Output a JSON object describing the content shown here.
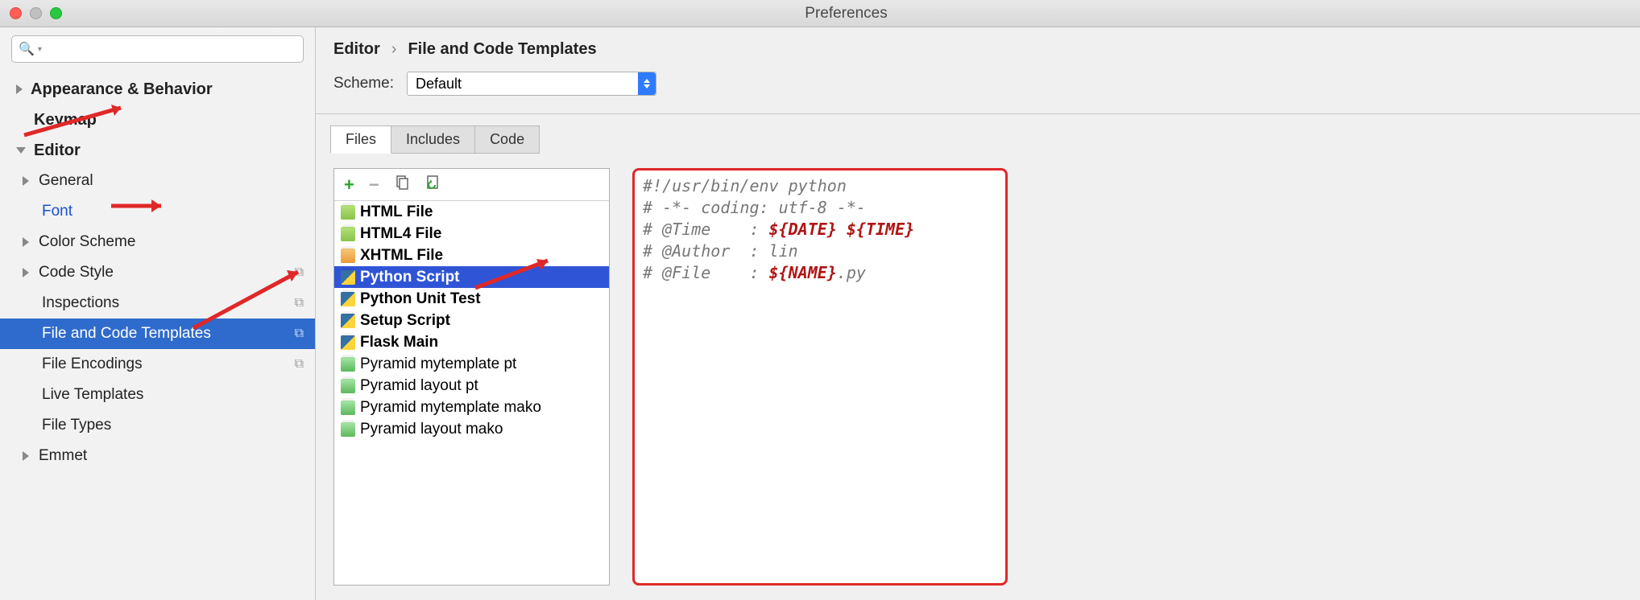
{
  "window": {
    "title": "Preferences"
  },
  "sidebar": {
    "search_placeholder": "",
    "items": {
      "appearance": "Appearance & Behavior",
      "keymap": "Keymap",
      "editor": "Editor",
      "general": "General",
      "font": "Font",
      "color_scheme": "Color Scheme",
      "code_style": "Code Style",
      "inspections": "Inspections",
      "file_code_templates": "File and Code Templates",
      "file_encodings": "File Encodings",
      "live_templates": "Live Templates",
      "file_types": "File Types",
      "emmet": "Emmet"
    }
  },
  "breadcrumb": {
    "a": "Editor",
    "b": "File and Code Templates"
  },
  "scheme": {
    "label": "Scheme:",
    "value": "Default"
  },
  "tabs": {
    "files": "Files",
    "includes": "Includes",
    "code": "Code"
  },
  "toolbar": {
    "add": "+",
    "remove": "−",
    "copy": "⧉",
    "revert": "↩"
  },
  "file_list": [
    {
      "name": "HTML File",
      "icon": "h",
      "bold": true
    },
    {
      "name": "HTML4 File",
      "icon": "h",
      "bold": true
    },
    {
      "name": "XHTML File",
      "icon": "h2",
      "bold": true
    },
    {
      "name": "Python Script",
      "icon": "py",
      "bold": true,
      "selected": true
    },
    {
      "name": "Python Unit Test",
      "icon": "py",
      "bold": true
    },
    {
      "name": "Setup Script",
      "icon": "py",
      "bold": true
    },
    {
      "name": "Flask Main",
      "icon": "py",
      "bold": true
    },
    {
      "name": "Pyramid mytemplate pt",
      "icon": "c",
      "bold": false
    },
    {
      "name": "Pyramid layout pt",
      "icon": "c",
      "bold": false
    },
    {
      "name": "Pyramid mytemplate mako",
      "icon": "m",
      "bold": false
    },
    {
      "name": "Pyramid layout mako",
      "icon": "m",
      "bold": false
    }
  ],
  "template": {
    "l1a": "#!/usr/bin/env python",
    "l2a": "# -*- coding: utf-8 -*-",
    "l3a": "# @Time    : ",
    "l3v1": "${DATE}",
    "l3s": " ",
    "l3v2": "${TIME}",
    "l4a": "# @Author  : lin",
    "l5a": "# @File    : ",
    "l5v": "${NAME}",
    "l5e": ".py"
  }
}
